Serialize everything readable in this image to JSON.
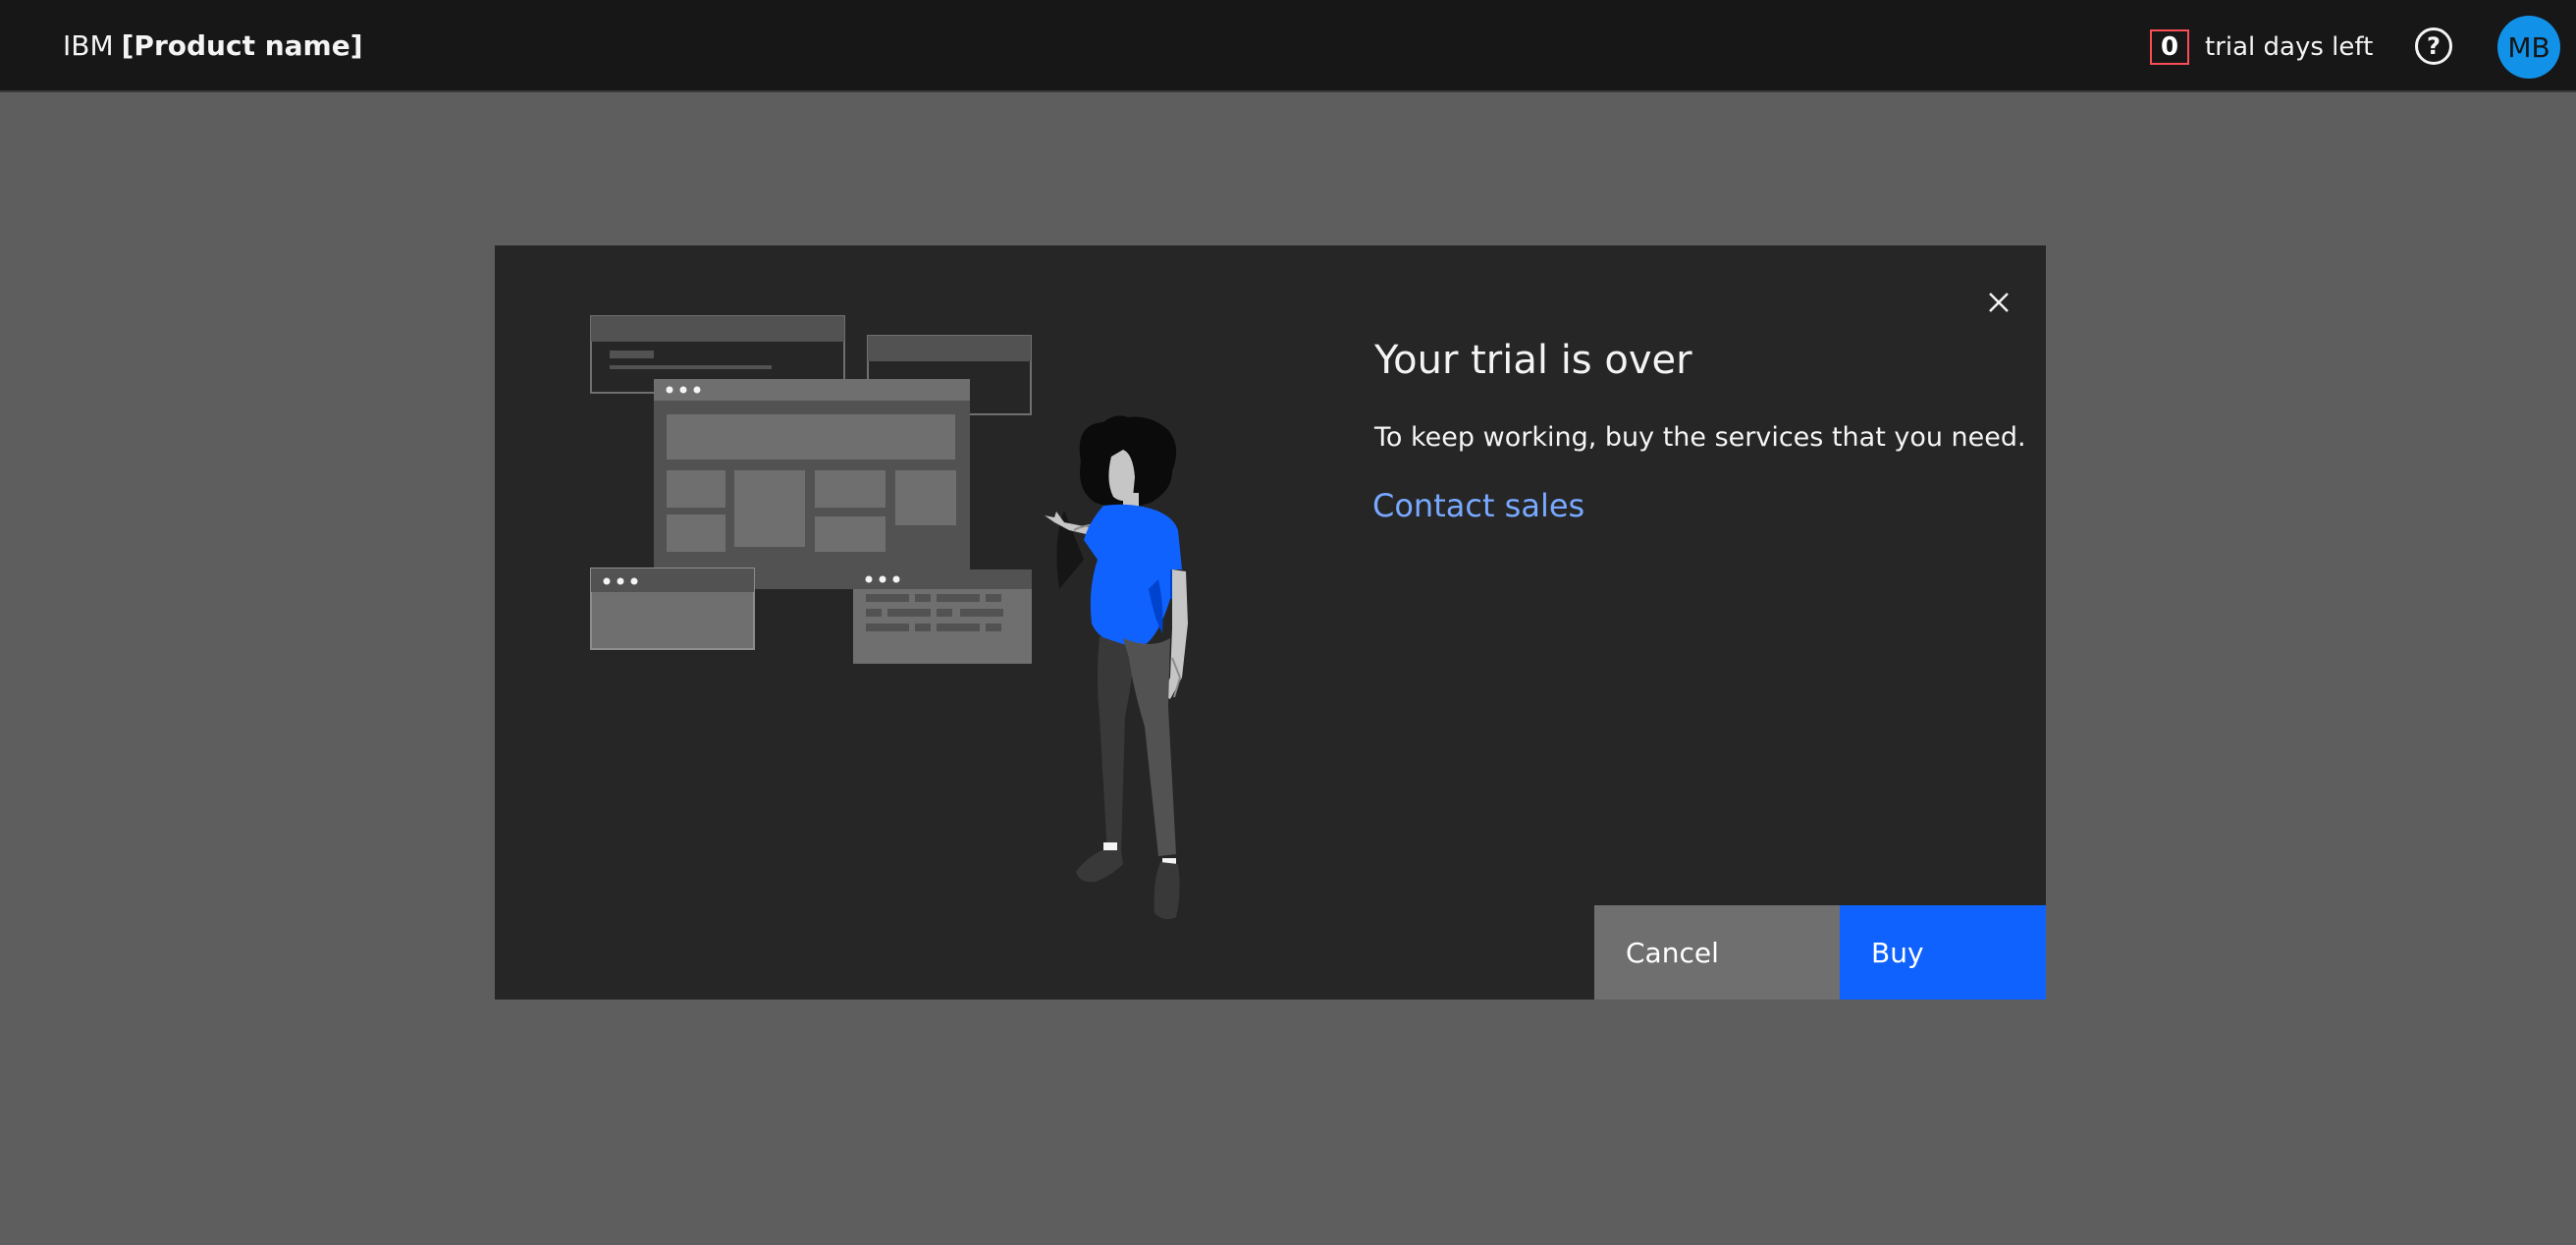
{
  "header": {
    "brand_prefix": "IBM",
    "product_name": "[Product name]",
    "trial_days_count": "0",
    "trial_days_label": "trial days left",
    "help_icon_glyph": "?",
    "avatar_initials": "MB",
    "colors": {
      "background": "#171717",
      "trial_border": "#fa4d56",
      "avatar_bg": "#1192e8"
    }
  },
  "modal": {
    "title": "Your trial is over",
    "body": "To keep working, buy the services that you need.",
    "link_label": "Contact sales",
    "cancel_label": "Cancel",
    "buy_label": "Buy",
    "close_icon": "close-icon",
    "illustration": "woman-pointing-at-app-windows",
    "colors": {
      "surface": "#262626",
      "primary": "#0f62fe",
      "secondary": "#6f6f6f",
      "link": "#78a9ff"
    }
  }
}
